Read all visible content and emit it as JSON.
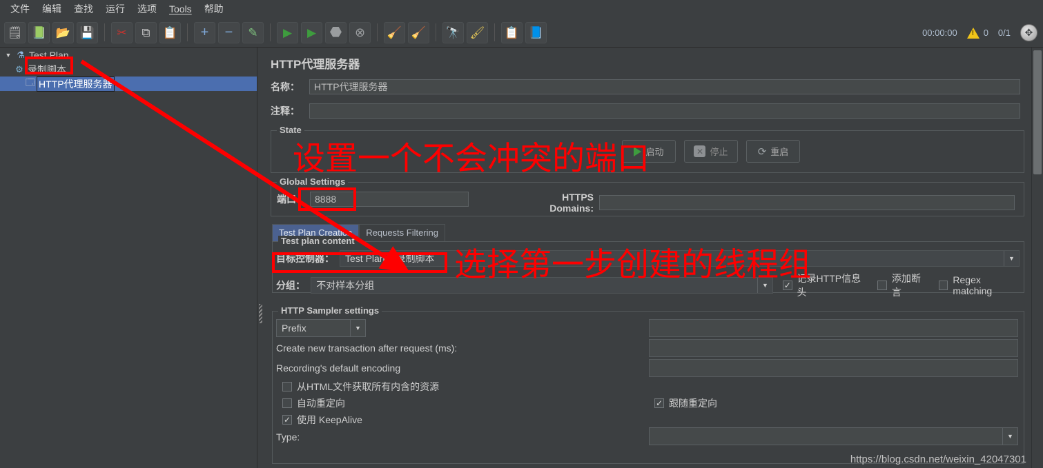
{
  "menubar": {
    "items": [
      {
        "label": "文件"
      },
      {
        "label": "编辑"
      },
      {
        "label": "查找"
      },
      {
        "label": "运行"
      },
      {
        "label": "选项"
      },
      {
        "label": "Tools"
      },
      {
        "label": "帮助"
      }
    ]
  },
  "toolbar": {
    "groups": [
      [
        {
          "name": "new-button",
          "glyph": "🗋",
          "title": "新建"
        },
        {
          "name": "templates-button",
          "glyph": "📚",
          "title": "模板"
        },
        {
          "name": "open-button",
          "glyph": "📂",
          "title": "打开"
        },
        {
          "name": "save-button",
          "glyph": "💾",
          "title": "保存"
        }
      ],
      [
        {
          "name": "cut-button",
          "glyph": "✂",
          "title": "剪切"
        },
        {
          "name": "copy-button",
          "glyph": "❐",
          "title": "复制"
        },
        {
          "name": "paste-button",
          "glyph": "📋",
          "title": "粘贴"
        }
      ],
      [
        {
          "name": "expand-all-button",
          "glyph": "＋",
          "title": "展开全部"
        },
        {
          "name": "collapse-all-button",
          "glyph": "－",
          "title": "折叠全部"
        },
        {
          "name": "toggle-button",
          "glyph": "🖉",
          "title": "启用/禁用"
        }
      ],
      [
        {
          "name": "start-button",
          "glyph": "▶",
          "title": "启动"
        },
        {
          "name": "start-no-pauses-button",
          "glyph": "▶",
          "title": "无间隔启动"
        },
        {
          "name": "stop-button",
          "glyph": "⬣",
          "title": "停止"
        },
        {
          "name": "shutdown-button",
          "glyph": "✖",
          "title": "关闭"
        }
      ],
      [
        {
          "name": "clear-button",
          "glyph": "🧹",
          "title": "清除"
        },
        {
          "name": "clear-all-button",
          "glyph": "🧹",
          "title": "清除全部"
        }
      ],
      [
        {
          "name": "search-button",
          "glyph": "🔎",
          "title": "搜索"
        },
        {
          "name": "reset-search-button",
          "glyph": "🖌",
          "title": "重置搜索"
        }
      ],
      [
        {
          "name": "function-helper-button",
          "glyph": "📑",
          "title": "函数助手"
        },
        {
          "name": "help-button",
          "glyph": "❓",
          "title": "帮助"
        }
      ]
    ],
    "status": {
      "timer": "00:00:00",
      "warning_count": "0",
      "threads": "0/1"
    }
  },
  "tree": {
    "nodes": [
      {
        "name": "tree-node-test-plan",
        "label": "Test Plan",
        "icon": "test-plan-icon",
        "depth": 0,
        "selected": false,
        "expanded": true
      },
      {
        "name": "tree-node-recording-script",
        "label": "录制脚本",
        "icon": "thread-group-icon",
        "depth": 1,
        "selected": false,
        "expanded": false
      },
      {
        "name": "tree-node-http-proxy-server",
        "label": "HTTP代理服务器",
        "icon": "http-proxy-icon",
        "depth": 2,
        "selected": true,
        "expanded": false
      }
    ]
  },
  "main": {
    "panel_title": "HTTP代理服务器",
    "name_label": "名称：",
    "name_value": "HTTP代理服务器",
    "comment_label": "注释：",
    "comment_value": "",
    "state": {
      "title": "State",
      "start_label": "启动",
      "stop_label": "停止",
      "restart_label": "重启"
    },
    "global_settings": {
      "title": "Global Settings",
      "port_label": "端口",
      "port_value": "8888",
      "https_domains_label": "HTTPS Domains:",
      "https_domains_value": ""
    },
    "tabs": [
      {
        "name": "tab-test-plan-creation",
        "label": "Test Plan Creation",
        "active": true
      },
      {
        "name": "tab-requests-filtering",
        "label": "Requests Filtering",
        "active": false
      }
    ],
    "test_plan_content": {
      "title": "Test plan content",
      "target_controller_label": "目标控制器：",
      "target_controller_value": "Test Plan > 录制脚本",
      "grouping_label": "分组：",
      "grouping_value": "不对样本分组",
      "checkboxes": [
        {
          "name": "capture-http-headers-checkbox",
          "label": "记录HTTP信息头",
          "checked": true
        },
        {
          "name": "add-assertions-checkbox",
          "label": "添加断言",
          "checked": false
        },
        {
          "name": "regex-matching-checkbox",
          "label": "Regex matching",
          "checked": false
        }
      ]
    },
    "sampler_settings": {
      "title": "HTTP Sampler settings",
      "naming_mode": "Prefix",
      "prefix_value": "",
      "transaction_label": "Create new transaction after request (ms):",
      "transaction_value": "",
      "encoding_label": "Recording's default encoding",
      "encoding_value": "",
      "checkboxes": [
        {
          "name": "retrieve-embedded-resources-checkbox",
          "label": "从HTML文件获取所有内含的资源",
          "checked": false
        },
        {
          "name": "auto-redirect-checkbox",
          "label": "自动重定向",
          "checked": false
        },
        {
          "name": "follow-redirects-checkbox",
          "label": "跟随重定向",
          "checked": true
        },
        {
          "name": "use-keepalive-checkbox",
          "label": "使用 KeepAlive",
          "checked": true
        }
      ],
      "type_label": "Type:",
      "type_value": ""
    }
  },
  "annotations": {
    "port_note": "设置一个不会冲突的端口",
    "target_controller_note": "选择第一步创建的线程组",
    "accent_color": "#fe0000"
  },
  "watermark": "https://blog.csdn.net/weixin_42047301"
}
